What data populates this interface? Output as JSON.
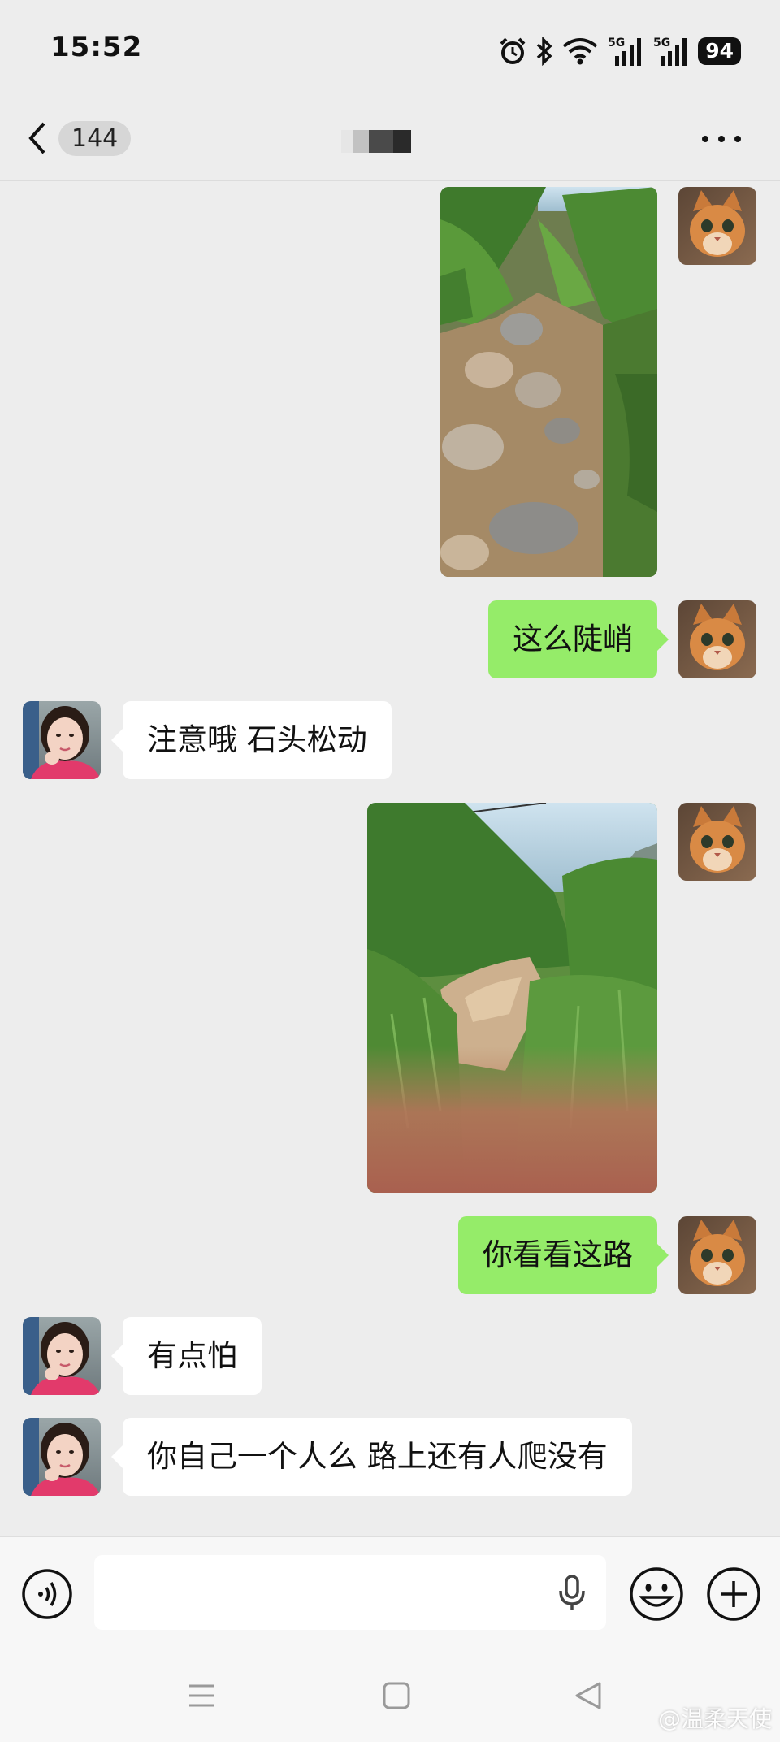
{
  "status_bar": {
    "time": "15:52",
    "battery": "94",
    "icons": [
      "alarm-icon",
      "bluetooth-icon",
      "wifi-icon",
      "5g-signal-icon",
      "5g-signal-icon"
    ]
  },
  "header": {
    "back_count": "144",
    "title_redacted": true
  },
  "messages": [
    {
      "side": "out",
      "type": "image",
      "description_icon": "rocky-trail-photo"
    },
    {
      "side": "out",
      "type": "text",
      "text": "这么陡峭"
    },
    {
      "side": "in",
      "type": "text",
      "text": "注意哦 石头松动"
    },
    {
      "side": "out",
      "type": "image",
      "description_icon": "overgrown-trail-photo"
    },
    {
      "side": "out",
      "type": "text",
      "text": "你看看这路"
    },
    {
      "side": "in",
      "type": "text",
      "text": "有点怕"
    },
    {
      "side": "in",
      "type": "text",
      "text": "你自己一个人么 路上还有人爬没有"
    }
  ],
  "input": {
    "value": "",
    "placeholder": ""
  },
  "watermark": "@温柔天使",
  "colors": {
    "background": "#ededed",
    "outgoing_bubble": "#95ec69",
    "incoming_bubble": "#ffffff"
  }
}
